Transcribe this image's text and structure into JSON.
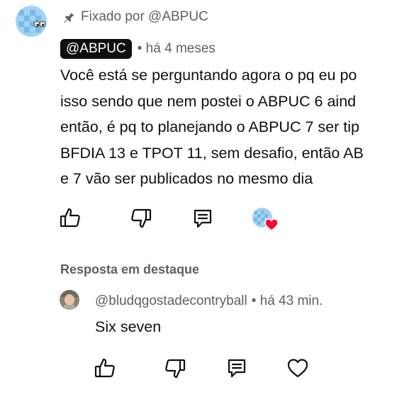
{
  "pinned": {
    "label": "Fixado por @ABPUC",
    "icon": "pin-icon"
  },
  "comment": {
    "author": "@ABPUC",
    "time": "• há 4 meses",
    "lines": [
      "Você está se perguntando agora o pq eu po",
      "isso sendo que nem postei o ABPUC 6 aind",
      "então, é pq to planejando o ABPUC 7 ser tip",
      "BFDIA 13 e TPOT 11, sem desafio, então AB",
      "e 7 vão ser publicados no mesmo dia"
    ],
    "actions": {
      "like_icon": "thumbs-up-icon",
      "dislike_icon": "thumbs-down-icon",
      "reply_icon": "reply-comment-icon",
      "creator_heart": "creator-heart-icon"
    }
  },
  "featured_reply": {
    "label": "Resposta em destaque",
    "author": "@bludqgostadecontryball",
    "time": "• há 43 min.",
    "text": "Six seven",
    "actions": {
      "like_icon": "thumbs-up-icon",
      "dislike_icon": "thumbs-down-icon",
      "reply_icon": "reply-comment-icon",
      "heart_icon": "heart-outline-icon"
    }
  },
  "colors": {
    "text_primary": "#0f0f0f",
    "text_secondary": "#606060",
    "chip_bg": "#0f0f0f",
    "heart_red": "#ff0033",
    "avatar_blue": "#8ec9ef"
  }
}
